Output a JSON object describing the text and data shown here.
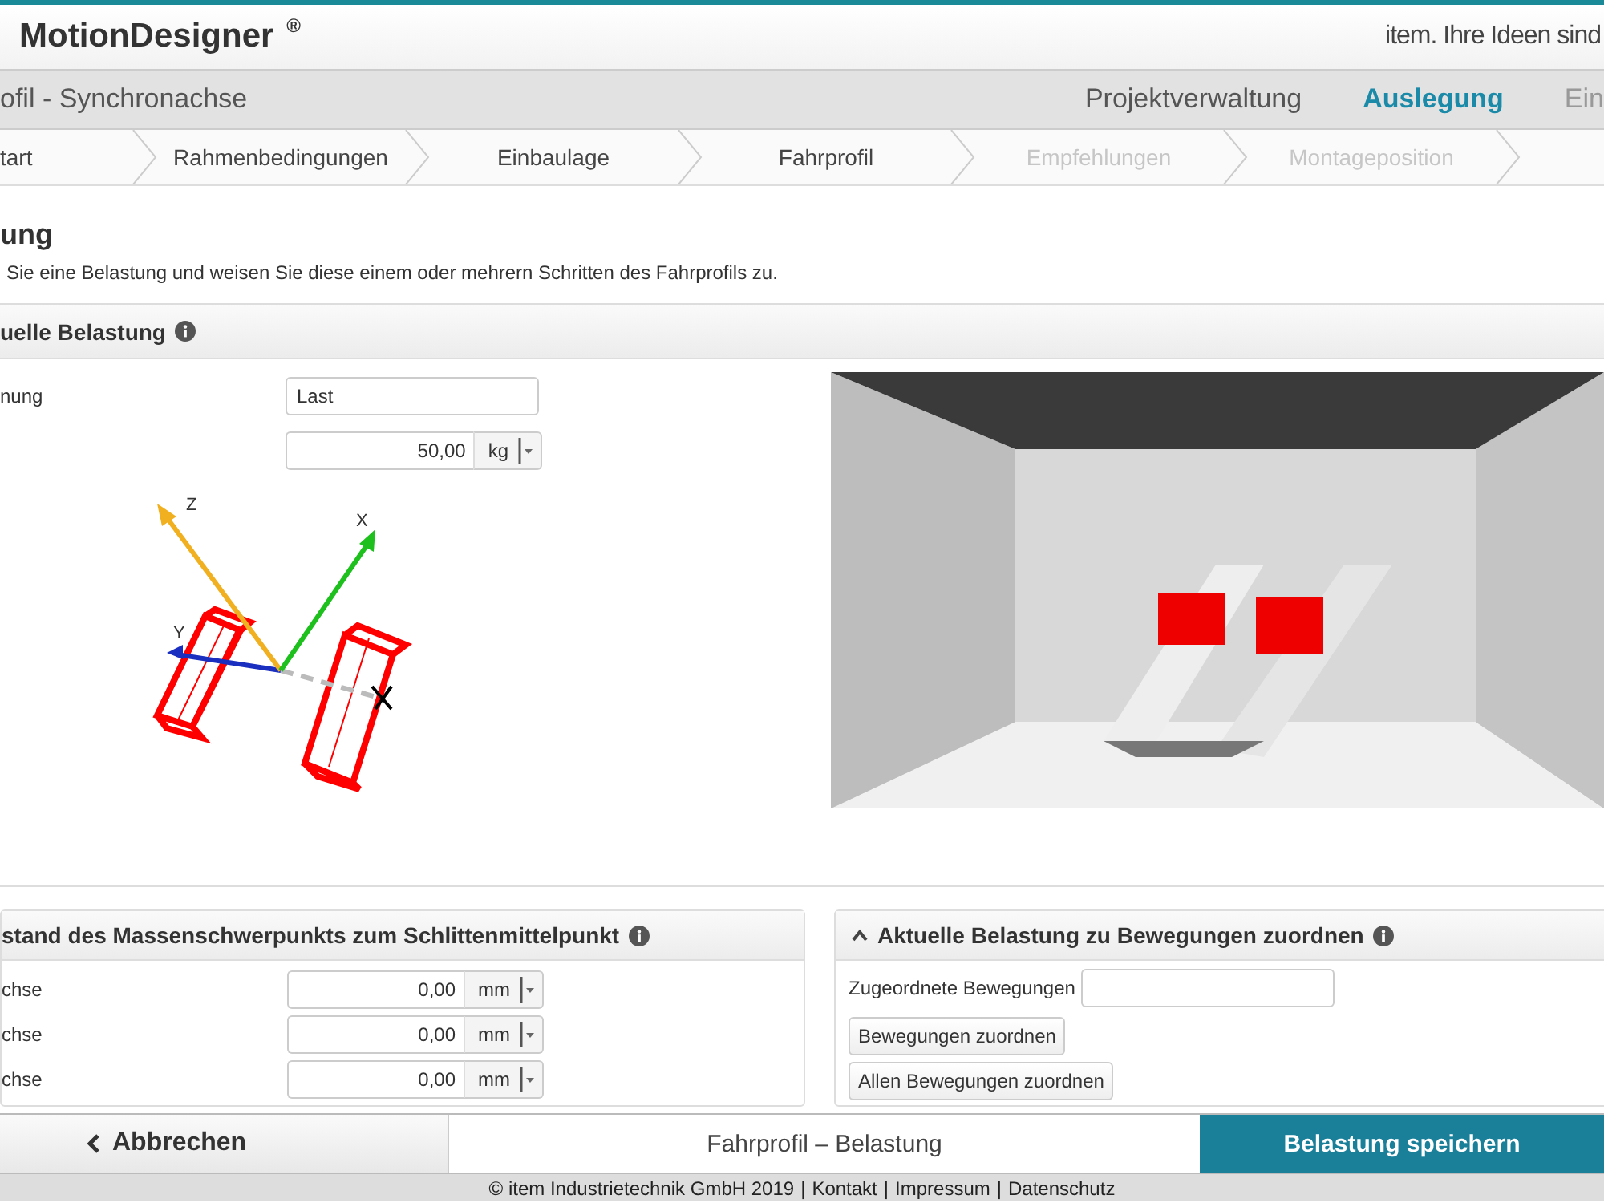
{
  "header": {
    "logo": "MotionDesigner",
    "trademark": "®",
    "slogan": "item. Ihre Ideen sind"
  },
  "project": {
    "title": "ofil - Synchronachse",
    "nav": [
      {
        "label": "Projektverwaltung",
        "selected": false,
        "disabled": false
      },
      {
        "label": "Auslegung",
        "selected": true,
        "disabled": false
      },
      {
        "label": "Ein",
        "selected": false,
        "disabled": true
      }
    ]
  },
  "steps": [
    {
      "label": "tart",
      "disabled": false
    },
    {
      "label": "Rahmenbedingungen",
      "disabled": false
    },
    {
      "label": "Einbaulage",
      "disabled": false
    },
    {
      "label": "Fahrprofil",
      "disabled": false
    },
    {
      "label": "Empfehlungen",
      "disabled": true
    },
    {
      "label": "Montageposition",
      "disabled": true
    }
  ],
  "page": {
    "heading": "ung",
    "intro": "Sie eine Belastung und weisen Sie diese einem oder mehrern Schritten des Fahrprofils zu."
  },
  "load_panel": {
    "title": "uelle Belastung",
    "fields": [
      {
        "kind": "text",
        "label": "nung",
        "value": "Last"
      },
      {
        "kind": "unit",
        "value": "50,00",
        "unit": "kg"
      }
    ],
    "axes": {
      "z": "Z",
      "x": "X",
      "y": "Y"
    }
  },
  "offset_panel": {
    "title": "stand des Massenschwerpunkts zum Schlittenmittelpunkt",
    "rows": [
      {
        "label": "chse",
        "value": "0,00",
        "unit": "mm"
      },
      {
        "label": "chse",
        "value": "0,00",
        "unit": "mm"
      },
      {
        "label": "chse",
        "value": "0,00",
        "unit": "mm"
      }
    ]
  },
  "assign_panel": {
    "title": "Aktuelle Belastung zu Bewegungen zuordnen",
    "expanded": true,
    "field_label": "Zugeordnete Bewegungen",
    "buttons": [
      "Bewegungen zuordnen",
      "Allen Bewegungen zuordnen"
    ]
  },
  "action_bar": {
    "cancel": "Abbrechen",
    "title": "Fahrprofil – Belastung",
    "save": "Belastung speichern"
  },
  "footer": {
    "copyright": "© item Industrietechnik GmbH 2019",
    "separator": "|",
    "links": [
      "Kontakt",
      "Impressum",
      "Datenschutz"
    ]
  }
}
